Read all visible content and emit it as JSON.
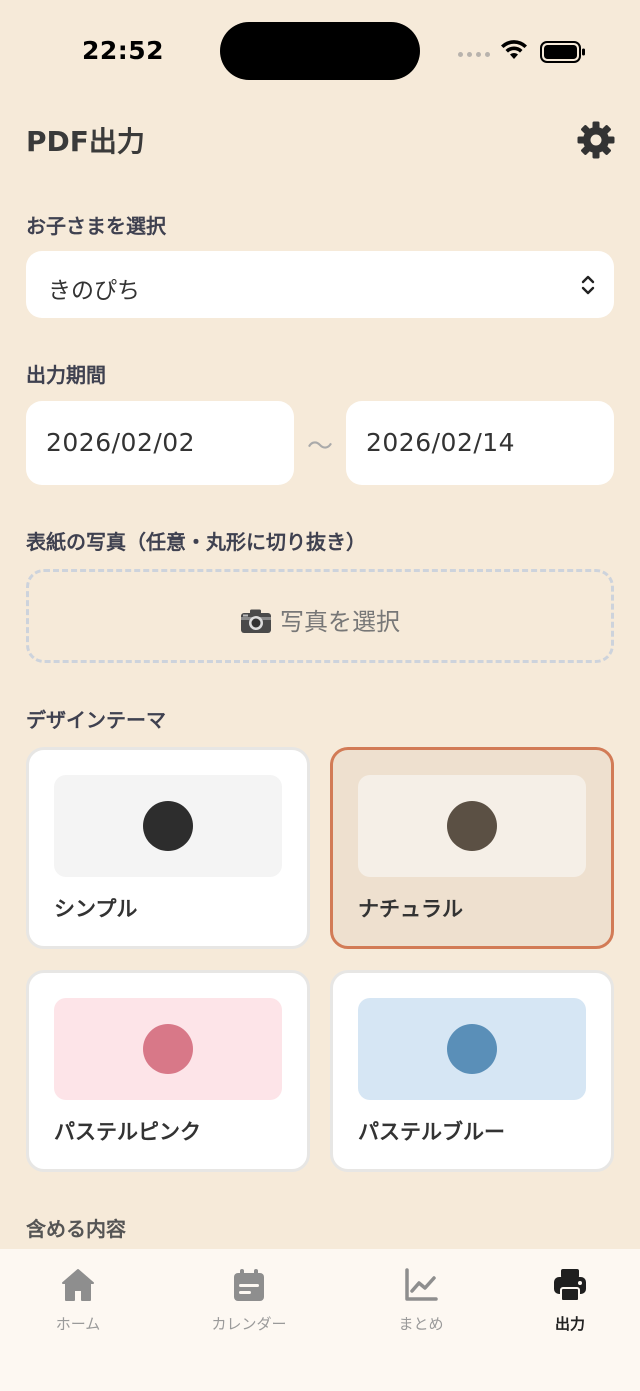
{
  "status": {
    "time": "22:52"
  },
  "header": {
    "title": "PDF出力",
    "settings_icon": "gear-icon"
  },
  "child": {
    "label": "お子さまを選択",
    "value": "きのぴち"
  },
  "period": {
    "label": "出力期間",
    "start": "2026/02/02",
    "separator": "〜",
    "end": "2026/02/14"
  },
  "cover": {
    "label": "表紙の写真（任意・丸形に切り抜き）",
    "button_label": "写真を選択",
    "icon": "camera-icon"
  },
  "theme": {
    "label": "デザインテーマ",
    "items": [
      {
        "name": "シンプル",
        "swatch": "#f4f4f4",
        "dot": "#2d2d2d",
        "selected": false
      },
      {
        "name": "ナチュラル",
        "swatch": "#f5efe7",
        "dot": "#5b5044",
        "selected": true
      },
      {
        "name": "パステルピンク",
        "swatch": "#fde4e8",
        "dot": "#d87888",
        "selected": false
      },
      {
        "name": "パステルブルー",
        "swatch": "#d6e6f4",
        "dot": "#5a8fb8",
        "selected": false
      }
    ]
  },
  "include": {
    "label": "含める内容"
  },
  "tabs": [
    {
      "label": "ホーム",
      "icon": "home-icon"
    },
    {
      "label": "カレンダー",
      "icon": "calendar-icon"
    },
    {
      "label": "まとめ",
      "icon": "chart-icon"
    },
    {
      "label": "出力",
      "icon": "printer-icon",
      "active": true
    }
  ],
  "colors": {
    "background": "#f6ead9",
    "accent": "#d27b56"
  }
}
